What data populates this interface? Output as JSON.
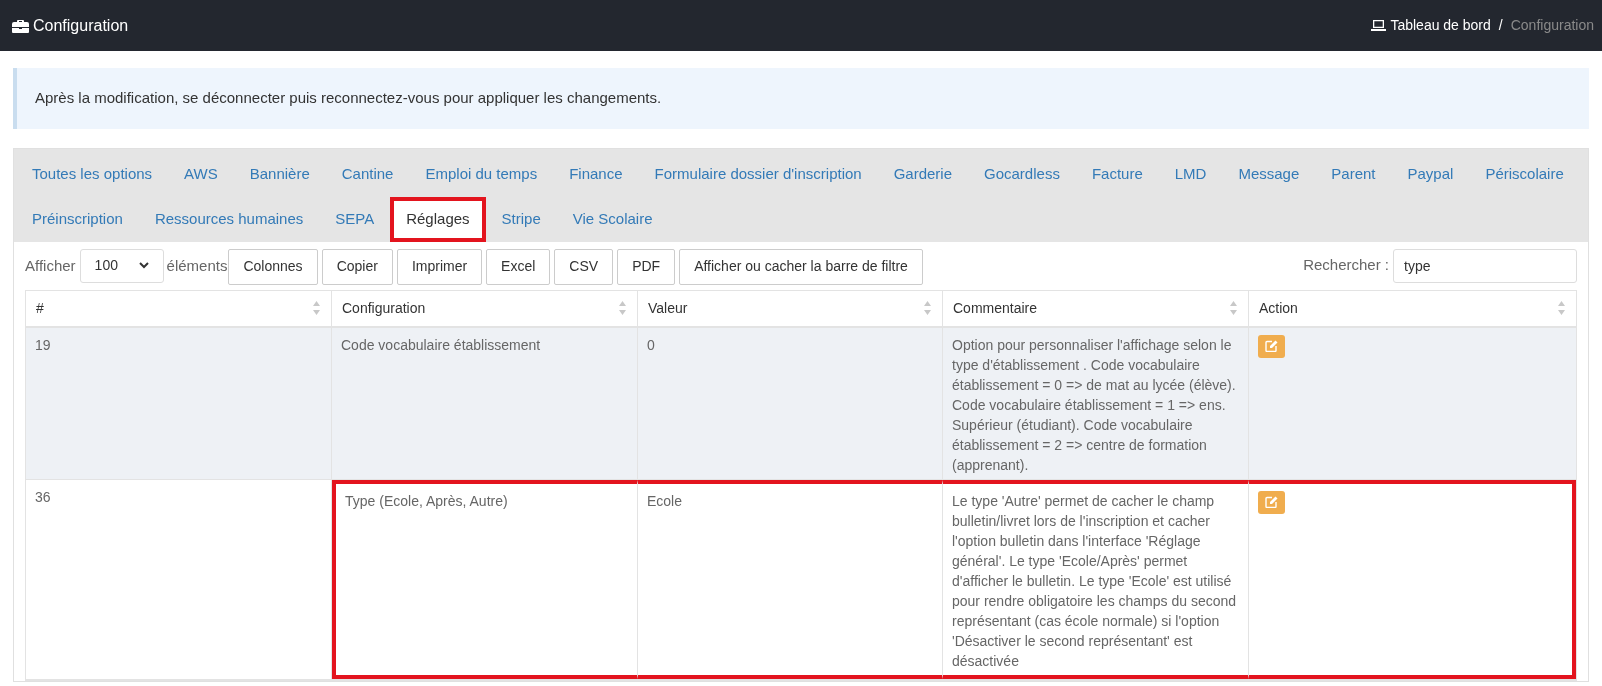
{
  "header": {
    "title": "Configuration",
    "breadcrumb": [
      {
        "label": "Tableau de bord",
        "kind": "link"
      },
      {
        "label": "Configuration",
        "kind": "current"
      }
    ],
    "separator": "/"
  },
  "alert": "Après la modification, se déconnecter puis reconnectez-vous pour appliquer les changements.",
  "tabs": [
    {
      "label": "Toutes les options",
      "selected": false,
      "highlighted": false
    },
    {
      "label": "AWS",
      "selected": false,
      "highlighted": false
    },
    {
      "label": "Bannière",
      "selected": false,
      "highlighted": false
    },
    {
      "label": "Cantine",
      "selected": false,
      "highlighted": false
    },
    {
      "label": "Emploi du temps",
      "selected": false,
      "highlighted": false
    },
    {
      "label": "Finance",
      "selected": false,
      "highlighted": false
    },
    {
      "label": "Formulaire dossier d'inscription",
      "selected": false,
      "highlighted": false
    },
    {
      "label": "Garderie",
      "selected": false,
      "highlighted": false
    },
    {
      "label": "Gocardless",
      "selected": false,
      "highlighted": false
    },
    {
      "label": "Facture",
      "selected": false,
      "highlighted": false
    },
    {
      "label": "LMD",
      "selected": false,
      "highlighted": false
    },
    {
      "label": "Message",
      "selected": false,
      "highlighted": false
    },
    {
      "label": "Parent",
      "selected": false,
      "highlighted": false
    },
    {
      "label": "Paypal",
      "selected": false,
      "highlighted": false
    },
    {
      "label": "Périscolaire",
      "selected": false,
      "highlighted": false
    },
    {
      "label": "Préinscription",
      "selected": false,
      "highlighted": false
    },
    {
      "label": "Ressources humaines",
      "selected": false,
      "highlighted": false
    },
    {
      "label": "SEPA",
      "selected": false,
      "highlighted": false
    },
    {
      "label": "Réglages",
      "selected": true,
      "highlighted": true
    },
    {
      "label": "Stripe",
      "selected": false,
      "highlighted": false
    },
    {
      "label": "Vie Scolaire",
      "selected": false,
      "highlighted": false
    }
  ],
  "controls": {
    "length_label": "Afficher",
    "length_value": "100",
    "length_suffix": "éléments",
    "buttons": [
      "Colonnes",
      "Copier",
      "Imprimer",
      "Excel",
      "CSV",
      "PDF",
      "Afficher ou cacher la barre de filtre"
    ],
    "search_label": "Rechercher :",
    "search_value": "type"
  },
  "table": {
    "columns": [
      "#",
      "Configuration",
      "Valeur",
      "Commentaire",
      "Action"
    ],
    "rows": [
      {
        "cells": [
          "19",
          "Code vocabulaire établissement",
          "0",
          "Option pour personnaliser l'affichage selon le type d'établissement . Code vocabulaire établissement = 0 => de mat au lycée (élève). Code vocabulaire établissement = 1 => ens. Supérieur (étudiant). Code vocabulaire établissement = 2 => centre de formation (apprenant)."
        ],
        "highlighted": false
      },
      {
        "cells": [
          "36",
          "Type (Ecole, Après, Autre)",
          "Ecole",
          "Le type 'Autre' permet de cacher le champ bulletin/livret lors de l'inscription et cacher l'option bulletin dans l'interface 'Réglage général'. Le type 'Ecole/Après' permet d'afficher le bulletin. Le type 'Ecole' est utilisé pour rendre obligatoire les champs du second représentant (cas école normale) si l'option 'Désactiver le second représentant' est désactivée"
        ],
        "highlighted": true
      }
    ]
  }
}
